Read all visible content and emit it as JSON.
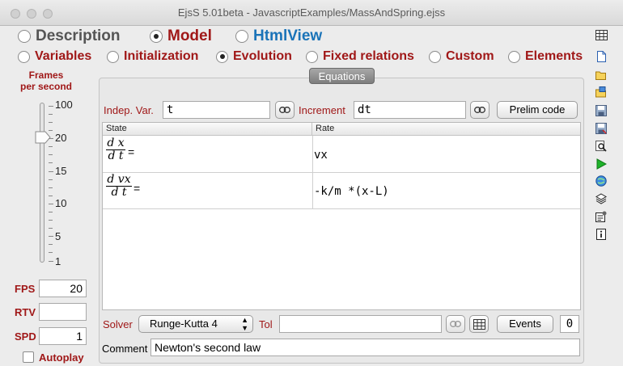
{
  "window": {
    "title": "EjsS 5.01beta - JavascriptExamples/MassAndSpring.ejss"
  },
  "main_tabs": [
    {
      "label": "Description",
      "selected": false,
      "color": "#555555"
    },
    {
      "label": "Model",
      "selected": true,
      "color": "#a01818"
    },
    {
      "label": "HtmlView",
      "selected": false,
      "color": "#1a73b8"
    }
  ],
  "sub_tabs": [
    {
      "label": "Variables",
      "selected": false
    },
    {
      "label": "Initialization",
      "selected": false
    },
    {
      "label": "Evolution",
      "selected": true
    },
    {
      "label": "Fixed relations",
      "selected": false
    },
    {
      "label": "Custom",
      "selected": false
    },
    {
      "label": "Elements",
      "selected": false
    }
  ],
  "fps_panel": {
    "title_line1": "Frames",
    "title_line2": "per second",
    "ticks": [
      "100",
      "20",
      "15",
      "10",
      "5",
      "1"
    ],
    "fps_label": "FPS",
    "fps_value": "20",
    "rtv_label": "RTV",
    "rtv_value": "",
    "spd_label": "SPD",
    "spd_value": "1",
    "autoplay_label": "Autoplay"
  },
  "equations": {
    "tab_label": "Equations",
    "indep_label": "Indep. Var.",
    "indep_value": "t",
    "increment_label": "Increment",
    "increment_value": "dt",
    "prelim_button": "Prelim code",
    "col_state": "State",
    "col_rate": "Rate",
    "rows": [
      {
        "num": "d x",
        "den": "d t",
        "eq": "=",
        "rate": "vx"
      },
      {
        "num": "d vx",
        "den": "d t",
        "eq": "=",
        "rate": "-k/m *(x-L)"
      }
    ],
    "solver_label": "Solver",
    "solver_value": "Runge-Kutta 4",
    "tol_label": "Tol",
    "tol_value": "",
    "events_button": "Events",
    "events_count": "0",
    "comment_label": "Comment",
    "comment_value": "Newton's second law"
  },
  "colors": {
    "accent_red": "#a01818",
    "accent_blue": "#1a73b8"
  }
}
